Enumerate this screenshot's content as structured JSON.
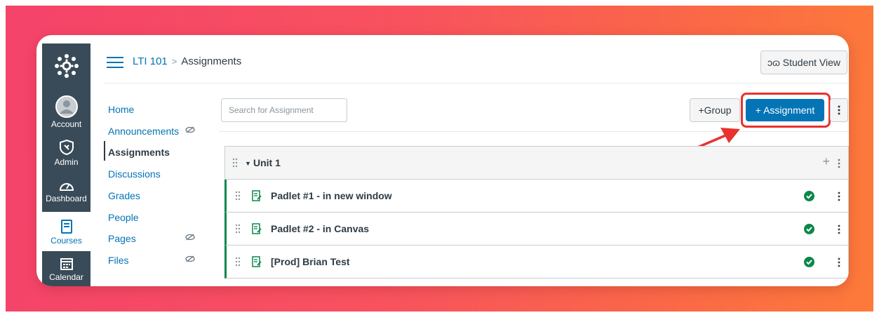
{
  "breadcrumb": {
    "course": "LTI 101",
    "separator": ">",
    "current": "Assignments"
  },
  "header": {
    "student_view_label": "Student View",
    "student_view_icon": "glasses-icon"
  },
  "global_nav": {
    "items": [
      {
        "label": "Account",
        "icon": "account-icon"
      },
      {
        "label": "Admin",
        "icon": "shield-icon"
      },
      {
        "label": "Dashboard",
        "icon": "dashboard-icon"
      },
      {
        "label": "Courses",
        "icon": "book-icon",
        "active": true
      },
      {
        "label": "Calendar",
        "icon": "calendar-icon"
      }
    ]
  },
  "course_nav": {
    "items": [
      {
        "label": "Home"
      },
      {
        "label": "Announcements",
        "hidden_icon": "eye-slash-icon"
      },
      {
        "label": "Assignments",
        "active": true
      },
      {
        "label": "Discussions"
      },
      {
        "label": "Grades"
      },
      {
        "label": "People"
      },
      {
        "label": "Pages",
        "hidden_icon": "eye-slash-icon"
      },
      {
        "label": "Files",
        "hidden_icon": "eye-slash-icon"
      }
    ]
  },
  "toolbar": {
    "search_placeholder": "Search for Assignment",
    "group_button": "+Group",
    "assignment_button": "+ Assignment"
  },
  "assignment_group": {
    "title": "Unit 1",
    "assignments": [
      {
        "title": "Padlet #1 - in new window",
        "status": "published"
      },
      {
        "title": "Padlet #2 - in Canvas",
        "status": "published"
      },
      {
        "title": "[Prod] Brian Test",
        "status": "published"
      }
    ]
  },
  "colors": {
    "brand": "#0374b5",
    "nav_bg": "#394b58",
    "published": "#0b874b",
    "annotation": "#e9322d",
    "backdrop_start": "#f5436a",
    "backdrop_end": "#fd7a3a"
  }
}
